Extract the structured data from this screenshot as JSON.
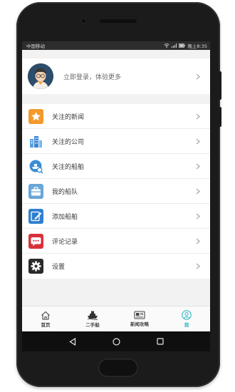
{
  "status_bar": {
    "carrier": "中国移动",
    "time": "晚上8:35"
  },
  "profile": {
    "prompt": "立即登录，体验更多",
    "avatar_icon": "user-avatar-icon"
  },
  "menu": {
    "items": [
      {
        "label": "关注的新闻",
        "icon": "star-icon",
        "color": "#f39a2b"
      },
      {
        "label": "关注的公司",
        "icon": "buildings-icon",
        "color": "#4a90d9"
      },
      {
        "label": "关注的船舶",
        "icon": "ship-search-icon",
        "color": "#3a8fd6"
      },
      {
        "label": "我的船队",
        "icon": "briefcase-icon",
        "color": "#6aa6d8"
      },
      {
        "label": "添加船舶",
        "icon": "edit-icon",
        "color": "#2f7fd0"
      },
      {
        "label": "评论记录",
        "icon": "comment-icon",
        "color": "#d9313a"
      },
      {
        "label": "设置",
        "icon": "gear-icon",
        "color": "#2a2a2a"
      }
    ]
  },
  "tabbar": {
    "tabs": [
      {
        "label": "首页",
        "icon": "home-icon"
      },
      {
        "label": "二手船",
        "icon": "ship-icon"
      },
      {
        "label": "新闻攻略",
        "icon": "newspaper-icon"
      },
      {
        "label": "我",
        "icon": "person-icon",
        "active": true
      }
    ],
    "active_color": "#30b8c3"
  }
}
